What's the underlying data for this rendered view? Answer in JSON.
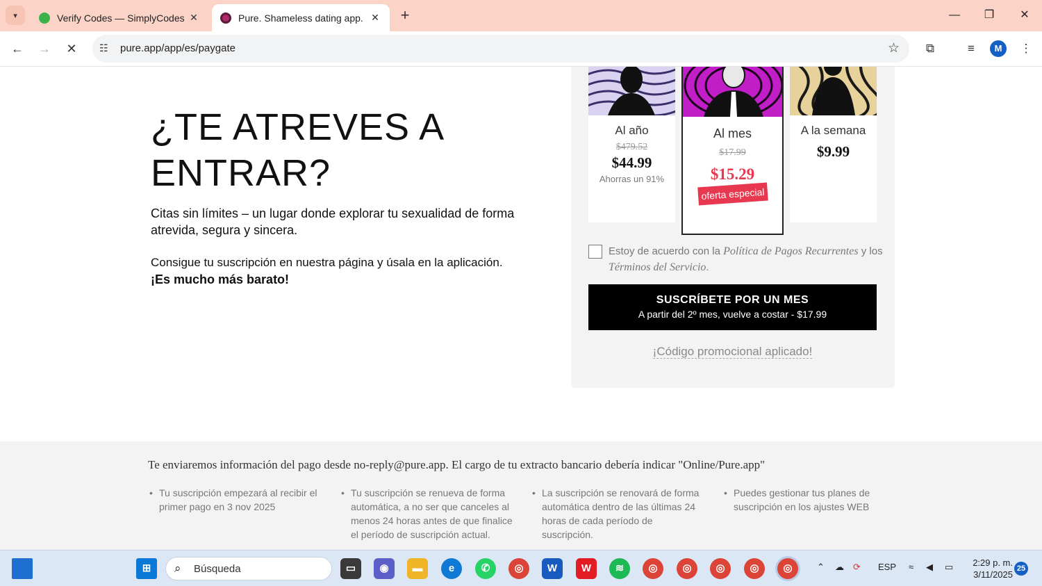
{
  "browser": {
    "tabs": [
      {
        "title": "Verify Codes — SimplyCodes",
        "active": false
      },
      {
        "title": "Pure. Shameless dating app.",
        "active": true
      }
    ],
    "url": "pure.app/app/es/paygate",
    "profile_initial": "M"
  },
  "hero": {
    "headline": "¿TE ATREVES A ENTRAR?",
    "intro": "Citas sin límites – un lugar donde explorar tu sexualidad de forma atrevida, segura y sincera.",
    "promo_text": "Consigue tu suscripción en nuestra página y úsala en la aplicación.",
    "promo_bold": "¡Es mucho más barato!"
  },
  "plans": [
    {
      "name": "Al año",
      "old_price": "$479.52",
      "price": "$44.99",
      "save": "Ahorras un 91%"
    },
    {
      "name": "Al mes",
      "old_price": "$17.99",
      "price": "$15.29",
      "badge": "oferta especial",
      "selected": true
    },
    {
      "name": "A la semana",
      "price": "$9.99"
    }
  ],
  "agreement": {
    "prefix": "Estoy de acuerdo con la",
    "policy": "Política de Pagos Recurrentes",
    "middle": "y los",
    "terms": "Términos del Servicio",
    "suffix": "."
  },
  "cta": {
    "title": "SUSCRÍBETE POR UN MES",
    "subtitle": "A partir del 2º mes, vuelve a costar - $17.99"
  },
  "promo_code": "¡Código promocional aplicado!",
  "footer": {
    "note": "Te enviaremos información del pago desde no-reply@pure.app. El cargo de tu extracto bancario debería indicar \"Online/Pure.app\"",
    "bullets": [
      "Tu suscripción empezará al recibir el primer pago en 3 nov 2025",
      "Tu suscripción se renueva de forma automática, a no ser que canceles al menos 24 horas antes de que finalice el período de suscripción actual.",
      "La suscripción se renovará de forma automática dentro de las últimas 24 horas de cada período de suscripción.",
      "Puedes gestionar tus planes de suscripción en los ajustes WEB"
    ]
  },
  "taskbar": {
    "search_placeholder": "Búsqueda",
    "lang": "ESP",
    "time": "2:29 p. m.",
    "date": "3/11/2025",
    "notifications": "25"
  }
}
